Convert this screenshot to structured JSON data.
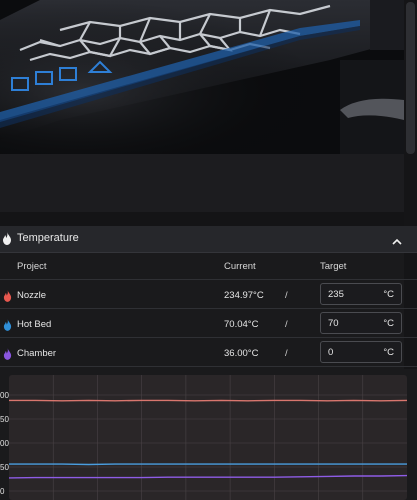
{
  "panel": {
    "title": "Temperature"
  },
  "table": {
    "headers": {
      "project": "Project",
      "current": "Current",
      "target": "Target"
    },
    "rows": [
      {
        "name": "Nozzle",
        "current": "234.97°C",
        "separator": "/",
        "target": "235",
        "unit": "°C",
        "color": "#e8584f"
      },
      {
        "name": "Hot Bed",
        "current": "70.04°C",
        "separator": "/",
        "target": "70",
        "unit": "°C",
        "color": "#2f8fd8"
      },
      {
        "name": "Chamber",
        "current": "36.00°C",
        "separator": "/",
        "target": "0",
        "unit": "°C",
        "color": "#8a56e0"
      }
    ]
  },
  "chart_data": {
    "type": "line",
    "ytick_labels": [
      "00",
      "50",
      "00",
      "50",
      "0"
    ],
    "ylim": [
      0,
      250
    ],
    "grid": true,
    "series": [
      {
        "color": "#d9766e",
        "values": [
          236,
          236,
          235,
          236,
          235,
          236,
          236,
          235,
          236,
          235,
          236,
          236,
          235,
          236,
          235,
          236
        ]
      },
      {
        "color": "#4a9ee0",
        "values": [
          70,
          70,
          70,
          69,
          70,
          70,
          70,
          70,
          70,
          70,
          70,
          70,
          70,
          70,
          70,
          70
        ]
      },
      {
        "color": "#8e5ce6",
        "values": [
          34,
          35,
          35,
          35,
          35,
          35,
          36,
          36,
          36,
          36,
          36,
          37,
          38,
          39,
          39,
          40
        ]
      }
    ]
  }
}
